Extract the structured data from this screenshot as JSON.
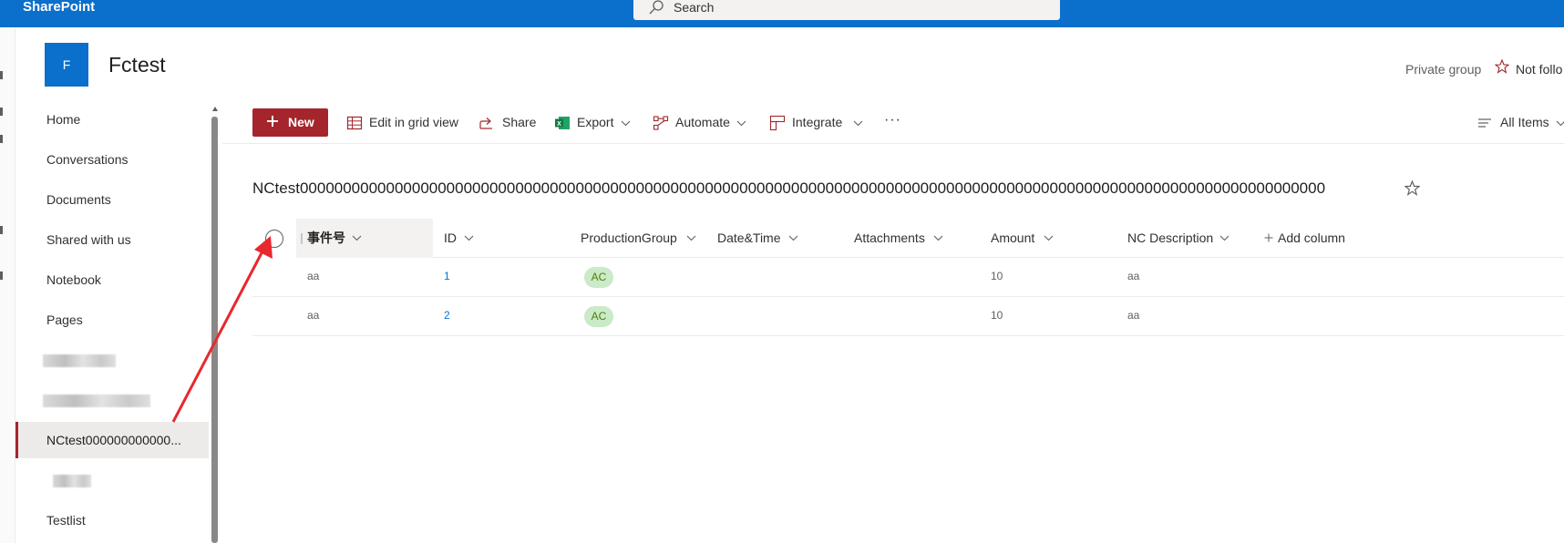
{
  "suite_bar": {
    "brand": "SharePoint",
    "search_placeholder": "Search",
    "background": "#0b6fcc"
  },
  "site": {
    "logo_letter": "F",
    "title": "Fctest",
    "group_type": "Private group",
    "follow_label": "Not follo"
  },
  "nav": {
    "items": [
      {
        "label": "Home"
      },
      {
        "label": "Conversations"
      },
      {
        "label": "Documents"
      },
      {
        "label": "Shared with us"
      },
      {
        "label": "Notebook"
      },
      {
        "label": "Pages"
      },
      {
        "label": ""
      },
      {
        "label": ""
      },
      {
        "label": "NCtest000000000000..."
      },
      {
        "label": ""
      },
      {
        "label": "Testlist"
      }
    ]
  },
  "command_bar": {
    "new_label": "New",
    "edit_grid_label": "Edit in grid view",
    "share_label": "Share",
    "export_label": "Export",
    "automate_label": "Automate",
    "integrate_label": "Integrate",
    "more_label": "···",
    "view_label": "All Items",
    "accent": "#a4262c"
  },
  "list": {
    "title": "NCtest00000000000000000000000000000000000000000000000000000000000000000000000000000000000000000000000000000000000000000000000",
    "columns": [
      {
        "label": "事件号"
      },
      {
        "label": "ID"
      },
      {
        "label": "ProductionGroup"
      },
      {
        "label": "Date&Time"
      },
      {
        "label": "Attachments"
      },
      {
        "label": "Amount"
      },
      {
        "label": "NC Description"
      }
    ],
    "add_column_label": "Add column",
    "rows": [
      {
        "event_no": "aa",
        "id": "1",
        "production_group": "AC",
        "datetime": "",
        "attachments": "",
        "amount": "10",
        "nc_description": "aa"
      },
      {
        "event_no": "aa",
        "id": "2",
        "production_group": "AC",
        "datetime": "",
        "attachments": "",
        "amount": "10",
        "nc_description": "aa"
      }
    ]
  },
  "icons": {
    "search": "search-icon",
    "plus": "plus-icon",
    "grid": "grid-icon",
    "share": "share-icon",
    "excel": "excel-icon",
    "automate": "automate-icon",
    "integrate": "integrate-icon",
    "view": "view-lines-icon",
    "star": "star-icon"
  },
  "annotation": {
    "color": "#e8282d"
  }
}
